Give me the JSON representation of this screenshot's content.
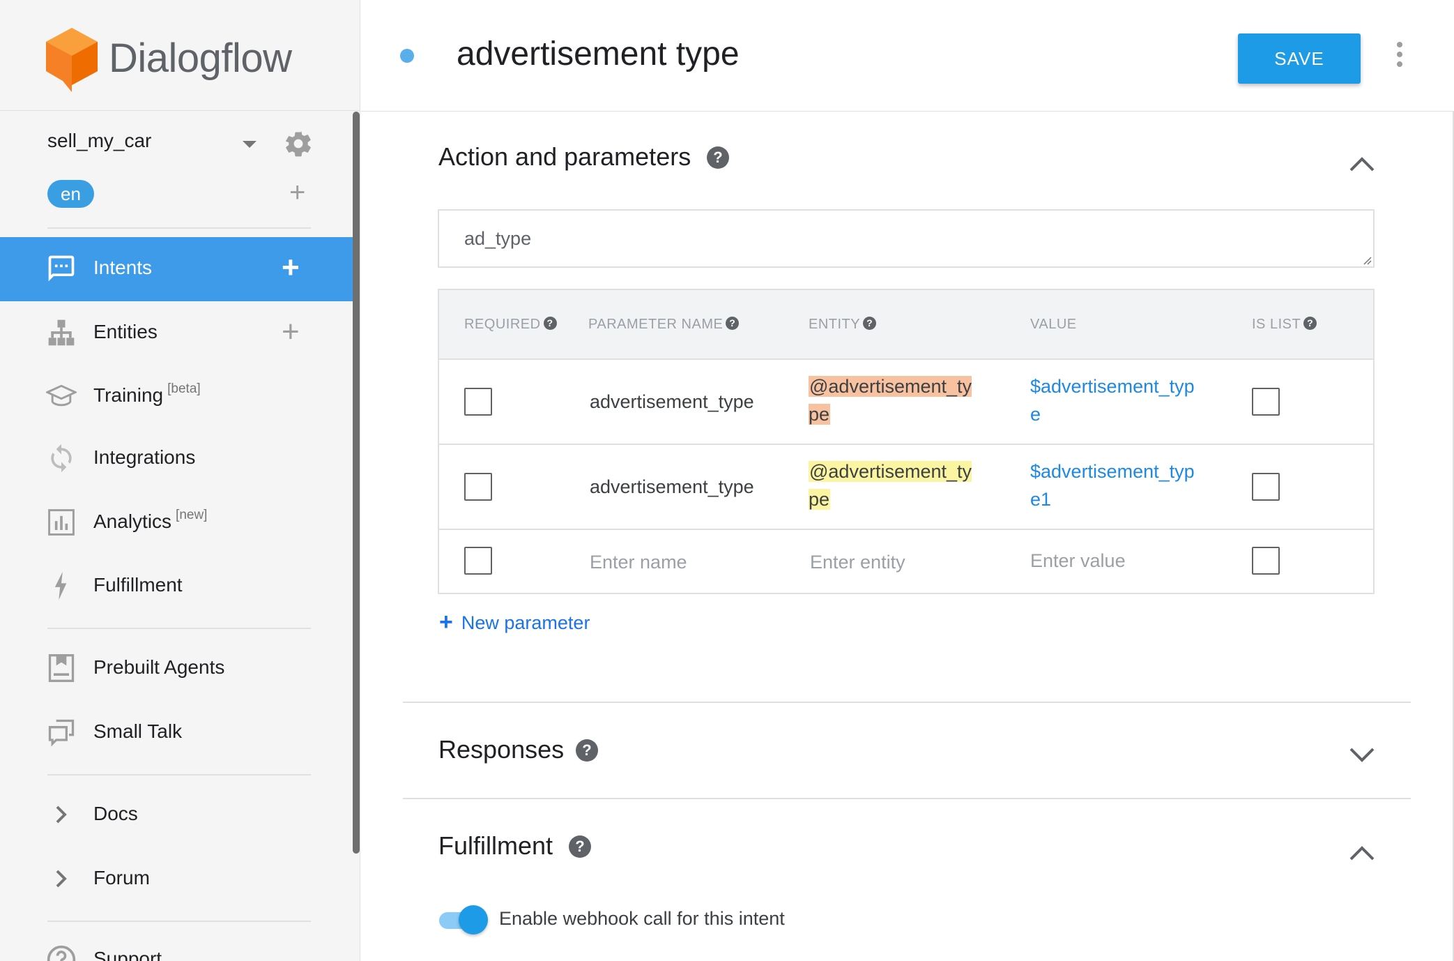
{
  "app": {
    "logo_text": "Dialogflow",
    "colors": {
      "brand_orange": "#f58025",
      "accent_blue": "#1e9be6",
      "active_nav": "#3d9be9"
    }
  },
  "sidebar": {
    "agent_name": "sell_my_car",
    "language": "en",
    "nav": [
      {
        "label": "Intents",
        "icon": "chat-bubble-icon",
        "active": true,
        "has_add": true,
        "add_label": "+"
      },
      {
        "label": "Entities",
        "icon": "hierarchy-icon",
        "has_add": true,
        "add_label": "+"
      },
      {
        "label": "Training",
        "sup": "[beta]",
        "icon": "graduation-cap-icon"
      },
      {
        "label": "Integrations",
        "icon": "sync-icon"
      },
      {
        "label": "Analytics",
        "sup": "[new]",
        "icon": "bar-chart-icon"
      },
      {
        "label": "Fulfillment",
        "icon": "lightning-icon"
      },
      {
        "label": "Prebuilt Agents",
        "icon": "book-icon"
      },
      {
        "label": "Small Talk",
        "icon": "chat-squares-icon"
      },
      {
        "label": "Docs",
        "icon": "chevron-right-icon"
      },
      {
        "label": "Forum",
        "icon": "chevron-right-icon"
      },
      {
        "label": "Support",
        "icon": "help-circle-icon"
      }
    ],
    "lang_add": "+"
  },
  "header": {
    "title": "advertisement type",
    "save_label": "SAVE"
  },
  "action_section": {
    "title": "Action and parameters",
    "help": "?",
    "action_value": "ad_type",
    "columns": {
      "required": "REQUIRED",
      "parameter_name": "PARAMETER NAME",
      "entity": "ENTITY",
      "value": "VALUE",
      "is_list": "IS LIST",
      "help": "?"
    },
    "rows": [
      {
        "required": false,
        "name": "advertisement_type",
        "entity": "@advertisement_type",
        "value": "$advertisement_type",
        "is_list": false
      },
      {
        "required": false,
        "name": "advertisement_type",
        "entity": "@advertisement_type",
        "value": "$advertisement_type1",
        "is_list": false
      }
    ],
    "empty_row": {
      "name_placeholder": "Enter name",
      "entity_placeholder": "Enter entity",
      "value_placeholder": "Enter value"
    },
    "new_parameter": "New parameter",
    "new_parameter_plus": "+"
  },
  "responses_section": {
    "title": "Responses",
    "help": "?"
  },
  "fulfillment_section": {
    "title": "Fulfillment",
    "help": "?",
    "webhook_toggle_label": "Enable webhook call for this intent",
    "webhook_enabled": true
  }
}
